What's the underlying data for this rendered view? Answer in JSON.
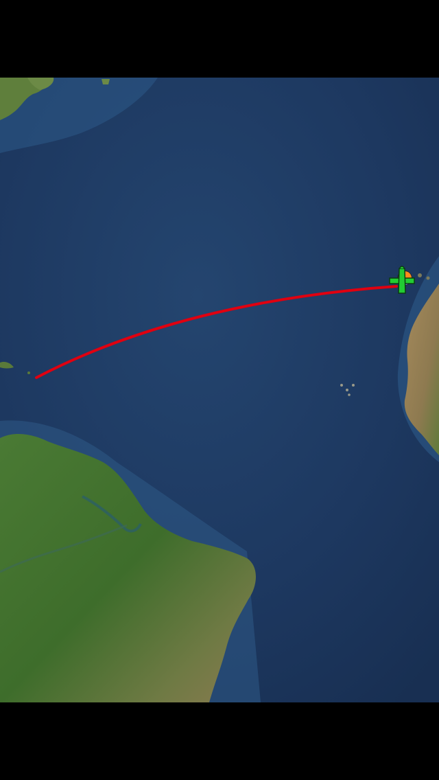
{
  "map": {
    "style": "satellite",
    "colors": {
      "ocean_deep": "#1b3258",
      "ocean_mid": "#22406b",
      "ocean_shelf": "#2f5a86",
      "land_forest": "#3f6e2c",
      "land_dry": "#8a7a4e",
      "land_desert": "#a68a5a",
      "flight_path": "#e00010",
      "plane_body": "#22cc33",
      "plane_outline": "#0b3d10"
    },
    "flight": {
      "status": "in-flight",
      "plane_icon": "airplane-icon",
      "marker_icon": "airport-marker-icon"
    }
  }
}
